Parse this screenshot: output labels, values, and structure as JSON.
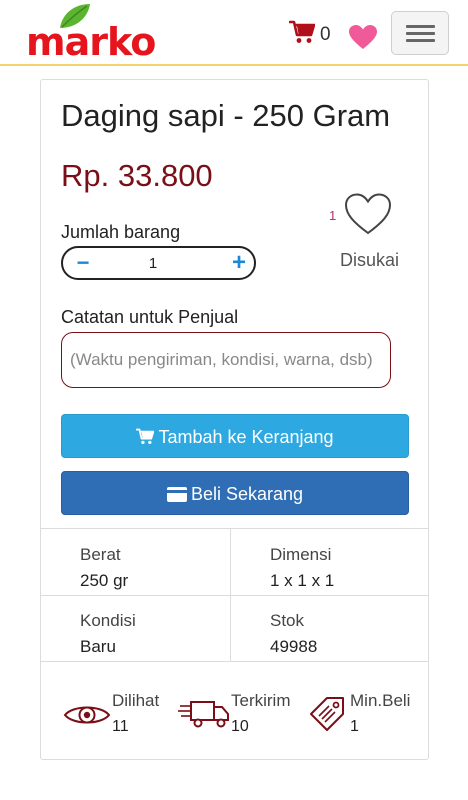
{
  "header": {
    "logo_text": "marko",
    "cart_count": "0",
    "brand_color": "#e5141d",
    "cart_icon": "shopping-cart-icon",
    "wishlist_icon": "heart-icon",
    "menu_icon": "hamburger-menu-icon"
  },
  "product": {
    "title": "Daging sapi - 250 Gram",
    "price": "Rp. 33.800",
    "price_color": "#7b0f17",
    "quantity_label": "Jumlah barang",
    "quantity_value": "1",
    "like_count": "1",
    "like_label": "Disukai",
    "note_label": "Catatan untuk Penjual",
    "note_placeholder": "(Waktu pengiriman, kondisi, warna, dsb)",
    "add_to_cart_label": "Tambah ke Keranjang",
    "buy_now_label": "Beli Sekarang"
  },
  "specs": [
    {
      "label": "Berat",
      "value": "250 gr"
    },
    {
      "label": "Dimensi",
      "value": "1 x 1 x 1"
    },
    {
      "label": "Kondisi",
      "value": "Baru"
    },
    {
      "label": "Stok",
      "value": "49988"
    }
  ],
  "stats": [
    {
      "label": "Dilihat",
      "value": "11",
      "icon": "eye-icon"
    },
    {
      "label": "Terkirim",
      "value": "10",
      "icon": "delivery-truck-icon"
    },
    {
      "label": "Min.Beli",
      "value": "1",
      "icon": "price-tag-icon"
    }
  ]
}
